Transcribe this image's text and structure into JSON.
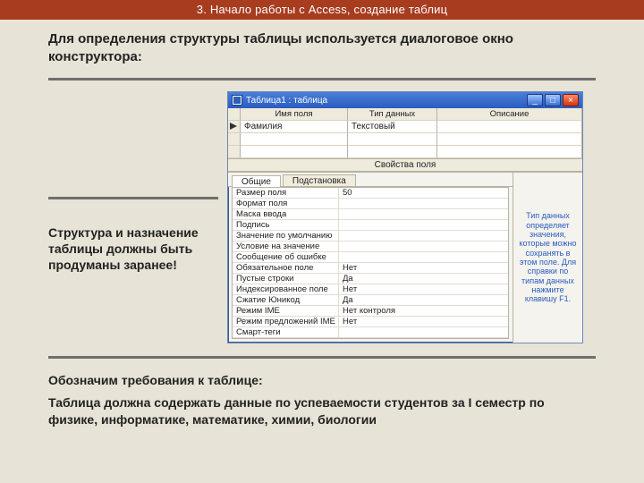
{
  "header": "3. Начало работы с Access, создание таблиц",
  "intro": "Для определения структуры таблицы используется диалоговое окно конструктора:",
  "caption": "Структура и назначение таблицы должны быть продуманы заранее!",
  "win": {
    "title": "Таблица1 : таблица",
    "columns": {
      "name": "Имя поля",
      "type": "Тип данных",
      "desc": "Описание"
    },
    "row": {
      "name": "Фамилия",
      "type": "Текстовый",
      "desc": ""
    },
    "section": "Свойства поля",
    "tabs": {
      "general": "Общие",
      "lookup": "Подстановка"
    },
    "props": [
      {
        "k": "Размер поля",
        "v": "50"
      },
      {
        "k": "Формат поля",
        "v": ""
      },
      {
        "k": "Маска ввода",
        "v": ""
      },
      {
        "k": "Подпись",
        "v": ""
      },
      {
        "k": "Значение по умолчанию",
        "v": ""
      },
      {
        "k": "Условие на значение",
        "v": ""
      },
      {
        "k": "Сообщение об ошибке",
        "v": ""
      },
      {
        "k": "Обязательное поле",
        "v": "Нет"
      },
      {
        "k": "Пустые строки",
        "v": "Да"
      },
      {
        "k": "Индексированное поле",
        "v": "Нет"
      },
      {
        "k": "Сжатие Юникод",
        "v": "Да"
      },
      {
        "k": "Режим IME",
        "v": "Нет контроля"
      },
      {
        "k": "Режим предложений IME",
        "v": "Нет"
      },
      {
        "k": "Смарт-теги",
        "v": ""
      }
    ],
    "help": "Тип данных определяет значения, которые можно сохранять в этом поле. Для справки по типам данных нажмите клавишу F1.",
    "buttons": {
      "min": "_",
      "max": "□",
      "close": "×"
    }
  },
  "req": {
    "title": "Обозначим требования к таблице:",
    "body": "Таблица должна содержать данные по успеваемости студентов за  I семестр по физике, информатике, математике, химии, биологии"
  }
}
